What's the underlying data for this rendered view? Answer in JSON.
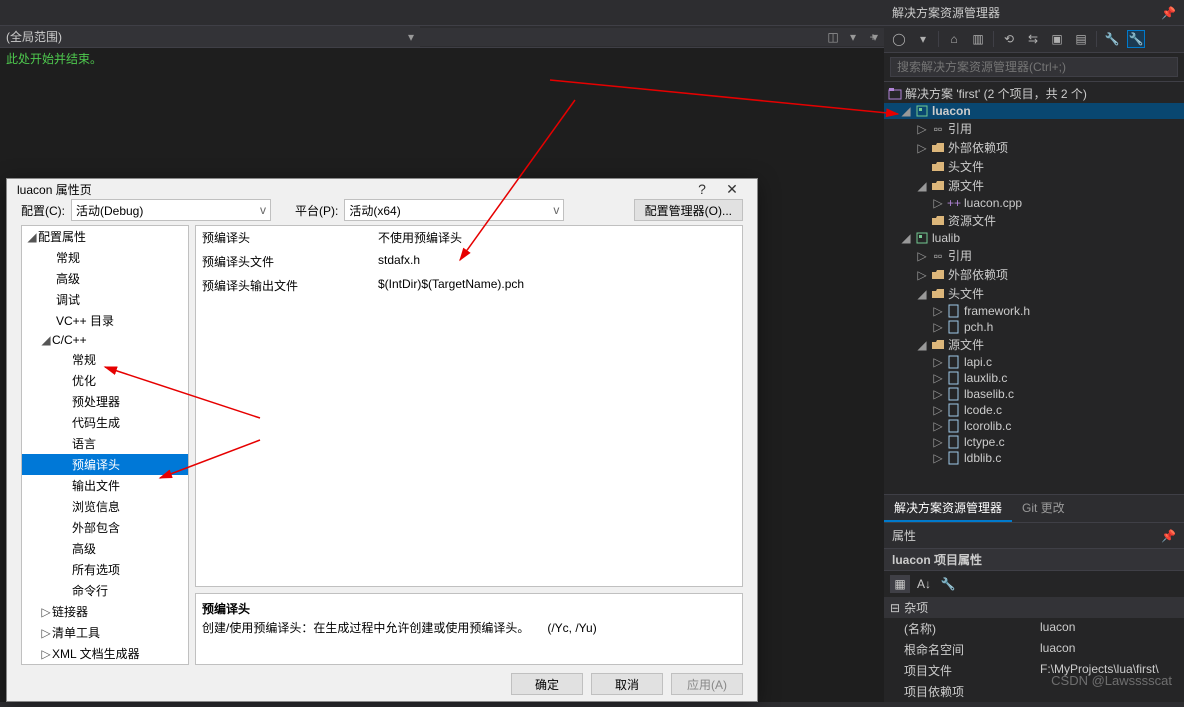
{
  "editor": {
    "scope_label": "(全局范围)",
    "code_line": "此处开始并结束。"
  },
  "dialog": {
    "title": "luacon 属性页",
    "config_label": "配置(C):",
    "config_value": "活动(Debug)",
    "platform_label": "平台(P):",
    "platform_value": "活动(x64)",
    "config_manager": "配置管理器(O)...",
    "tree": {
      "root": "配置属性",
      "items": [
        "常规",
        "高级",
        "调试",
        "VC++ 目录"
      ],
      "cpp": "C/C++",
      "cpp_items": [
        "常规",
        "优化",
        "预处理器",
        "代码生成",
        "语言",
        "预编译头",
        "输出文件",
        "浏览信息",
        "外部包含",
        "高级",
        "所有选项",
        "命令行"
      ],
      "selected": "预编译头",
      "after": [
        "链接器",
        "清单工具",
        "XML 文档生成器"
      ]
    },
    "props": [
      {
        "name": "预编译头",
        "value": "不使用预编译头"
      },
      {
        "name": "预编译头文件",
        "value": "stdafx.h"
      },
      {
        "name": "预编译头输出文件",
        "value": "$(IntDir)$(TargetName).pch"
      }
    ],
    "desc": {
      "title": "预编译头",
      "body": "创建/使用预编译头：在生成过程中允许创建或使用预编译头。　　(/Yc, /Yu)"
    },
    "buttons": {
      "ok": "确定",
      "cancel": "取消",
      "apply": "应用(A)"
    }
  },
  "solution_explorer": {
    "title": "解决方案资源管理器",
    "search_placeholder": "搜索解决方案资源管理器(Ctrl+;)",
    "solution": "解决方案 'first' (2 个项目，共 2 个)",
    "proj1": {
      "name": "luacon",
      "refs": "引用",
      "ext": "外部依赖项",
      "headers": "头文件",
      "sources": "源文件",
      "src_file": "luacon.cpp",
      "res": "资源文件"
    },
    "proj2": {
      "name": "lualib",
      "refs": "引用",
      "ext": "外部依赖项",
      "headers": "头文件",
      "h_files": [
        "framework.h",
        "pch.h"
      ],
      "sources": "源文件",
      "src_files": [
        "lapi.c",
        "lauxlib.c",
        "lbaselib.c",
        "lcode.c",
        "lcorolib.c",
        "lctype.c",
        "ldblib.c"
      ]
    },
    "tabs": {
      "active": "解决方案资源管理器",
      "other": "Git 更改"
    }
  },
  "properties_panel": {
    "title": "属性",
    "object": "luacon 项目属性",
    "category": "杂项",
    "rows": [
      {
        "n": "(名称)",
        "v": "luacon"
      },
      {
        "n": "根命名空间",
        "v": "luacon"
      },
      {
        "n": "项目文件",
        "v": "F:\\MyProjects\\lua\\first\\"
      },
      {
        "n": "项目依赖项",
        "v": ""
      }
    ]
  },
  "watermark": "CSDN @Lawsssscat"
}
